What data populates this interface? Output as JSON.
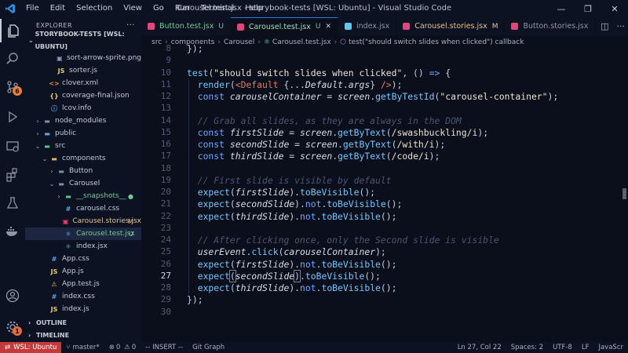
{
  "app": {
    "title": "Carousel.test.jsx - storybook-tests [WSL: Ubuntu] - Visual Studio Code",
    "menu": [
      "File",
      "Edit",
      "Selection",
      "View",
      "Go",
      "Run",
      "Terminal",
      "Help"
    ]
  },
  "activity": {
    "scm_badge": "6",
    "settings_badge": "1"
  },
  "sidebar": {
    "header": "EXPLORER",
    "root": "STORYBOOK-TESTS [WSL: UBUNTU]",
    "items": [
      {
        "label": "sort-arrow-sprite.png",
        "icon": "▣",
        "icon_color": "#8aa0b8",
        "status": ""
      },
      {
        "label": "sorter.js",
        "icon": "JS",
        "icon_color": "#e8c86a",
        "status": ""
      },
      {
        "label": "clover.xml",
        "icon": "<>",
        "icon_color": "#e28a4f",
        "status": ""
      },
      {
        "label": "coverage-final.json",
        "icon": "{}",
        "icon_color": "#e8c86a",
        "status": ""
      },
      {
        "label": "lcov.info",
        "icon": "ⓘ",
        "icon_color": "#5aa6e8",
        "status": ""
      },
      {
        "label": "node_modules",
        "icon": "▬",
        "icon_color": "#7b8fa8",
        "status": ""
      },
      {
        "label": "public",
        "icon": "▬",
        "icon_color": "#5aa6e8",
        "status": ""
      },
      {
        "label": "src",
        "icon": "▬",
        "icon_color": "#5cc08a",
        "status": ""
      },
      {
        "label": "components",
        "icon": "▬",
        "icon_color": "#d9b64a",
        "status": ""
      },
      {
        "label": "Button",
        "icon": "▬",
        "icon_color": "#7b8fa8",
        "status": ""
      },
      {
        "label": "Carousel",
        "icon": "▬",
        "icon_color": "#7b8fa8",
        "status": ""
      },
      {
        "label": "__snapshots__",
        "icon": "▬",
        "icon_color": "#5cc08a",
        "status": "●"
      },
      {
        "label": "carousel.css",
        "icon": "#",
        "icon_color": "#5aa6e8",
        "status": ""
      },
      {
        "label": "Carousel.stories.jsx",
        "icon": "▣",
        "icon_color": "#e0457b",
        "status": "M"
      },
      {
        "label": "Carousel.test.jsx",
        "icon": "⚛",
        "icon_color": "#5ec8e8",
        "status": "U"
      },
      {
        "label": "index.jsx",
        "icon": "⚛",
        "icon_color": "#5ec8e8",
        "status": ""
      },
      {
        "label": "App.css",
        "icon": "#",
        "icon_color": "#5aa6e8",
        "status": ""
      },
      {
        "label": "App.js",
        "icon": "JS",
        "icon_color": "#e8c86a",
        "status": ""
      },
      {
        "label": "App.test.js",
        "icon": "⚠",
        "icon_color": "#e8c86a",
        "status": ""
      },
      {
        "label": "index.css",
        "icon": "#",
        "icon_color": "#5aa6e8",
        "status": ""
      },
      {
        "label": "index.js",
        "icon": "JS",
        "icon_color": "#e8c86a",
        "status": ""
      }
    ],
    "outline": "OUTLINE",
    "timeline": "TIMELINE"
  },
  "tabs": [
    {
      "label": "Button.test.jsx",
      "status": "U",
      "icon_color": "#e0457b"
    },
    {
      "label": "Carousel.test.jsx",
      "status": "U",
      "icon_color": "#e0457b"
    },
    {
      "label": "index.jsx",
      "status": "",
      "icon_color": "#5ec8e8"
    },
    {
      "label": "Carousel.stories.jsx",
      "status": "M",
      "icon_color": "#e0457b"
    },
    {
      "label": "Button.stories.jsx",
      "status": "",
      "icon_color": "#e0457b"
    }
  ],
  "breadcrumb": [
    "src",
    "components",
    "Carousel",
    "Carousel.test.jsx",
    "test(\"should switch slides when clicked\") callback"
  ],
  "editor": {
    "current_line": 27,
    "lines": [
      {
        "n": "8",
        "html": "<span>});</span>"
      },
      {
        "n": "9",
        "html": ""
      },
      {
        "n": "10",
        "html": "<span class='fn'>test</span>(<span class='s'>\"should switch slides when clicked\"</span>, () <span class='k'>=&gt;</span> {"
      },
      {
        "n": "11",
        "html": "  <span class='fn'>render</span>(<span class='tag'>&lt;Default</span> {...<span class='v'>Default</span>.<span class='v'>args</span>} <span class='tag'>/&gt;</span>);"
      },
      {
        "n": "12",
        "html": "  <span class='k'>const</span> <span class='v'>carouselContainer</span> = <span class='v'>screen</span>.<span class='fn'>getByTestId</span>(<span class='s'>\"carousel-container\"</span>);"
      },
      {
        "n": "13",
        "html": ""
      },
      {
        "n": "14",
        "html": "  <span class='c'>// Grab all slides, as they are always in the DOM</span>"
      },
      {
        "n": "15",
        "html": "  <span class='k'>const</span> <span class='v'>firstSlide</span> = <span class='v'>screen</span>.<span class='fn'>getByText</span>(<span class='s'>/swashbuckling/i</span>);"
      },
      {
        "n": "16",
        "html": "  <span class='k'>const</span> <span class='v'>secondSlide</span> = <span class='v'>screen</span>.<span class='fn'>getByText</span>(<span class='s'>/with/i</span>);"
      },
      {
        "n": "17",
        "html": "  <span class='k'>const</span> <span class='v'>thirdSlide</span> = <span class='v'>screen</span>.<span class='fn'>getByText</span>(<span class='s'>/code/i</span>);"
      },
      {
        "n": "18",
        "html": ""
      },
      {
        "n": "19",
        "html": "  <span class='c'>// First slide is visible by default</span>"
      },
      {
        "n": "20",
        "html": "  <span class='fn'>expect</span>(<span class='v'>firstSlide</span>).<span class='fn'>toBeVisible</span>();"
      },
      {
        "n": "21",
        "html": "  <span class='fn'>expect</span>(<span class='v'>secondSlide</span>).<span class='k'>not</span>.<span class='fn'>toBeVisible</span>();"
      },
      {
        "n": "22",
        "html": "  <span class='fn'>expect</span>(<span class='v'>thirdSlide</span>).<span class='k'>not</span>.<span class='fn'>toBeVisible</span>();"
      },
      {
        "n": "23",
        "html": ""
      },
      {
        "n": "24",
        "html": "  <span class='c'>// After clicking once, only the Second slide is visible</span>"
      },
      {
        "n": "25",
        "html": "  <span class='v'>userEvent</span>.<span class='fn'>click</span>(<span class='v'>carouselContainer</span>);"
      },
      {
        "n": "26",
        "html": "  <span class='fn'>expect</span>(<span class='v'>firstSlide</span>).<span class='k'>not</span>.<span class='fn'>toBeVisible</span>();"
      },
      {
        "n": "27",
        "html": "  <span class='fn'>expect</span><span class='br'>(</span><span class='v'>secondSlide</span><span class='br'>)</span>.<span class='fn'>toBeVisible</span>();"
      },
      {
        "n": "28",
        "html": "  <span class='fn'>expect</span>(<span class='v'>thirdSlide</span>).<span class='k'>not</span>.<span class='fn'>toBeVisible</span>();"
      },
      {
        "n": "29",
        "html": "});"
      },
      {
        "n": "30",
        "html": ""
      }
    ]
  },
  "status": {
    "remote": "WSL: Ubuntu",
    "branch": "master*",
    "errors": "0",
    "warnings": "0",
    "mode": "-- INSERT --",
    "git_graph": "Git Graph",
    "position": "Ln 27, Col 22",
    "spaces": "Spaces: 2",
    "encoding": "UTF-8",
    "eol": "LF",
    "language": "JavaScr"
  }
}
